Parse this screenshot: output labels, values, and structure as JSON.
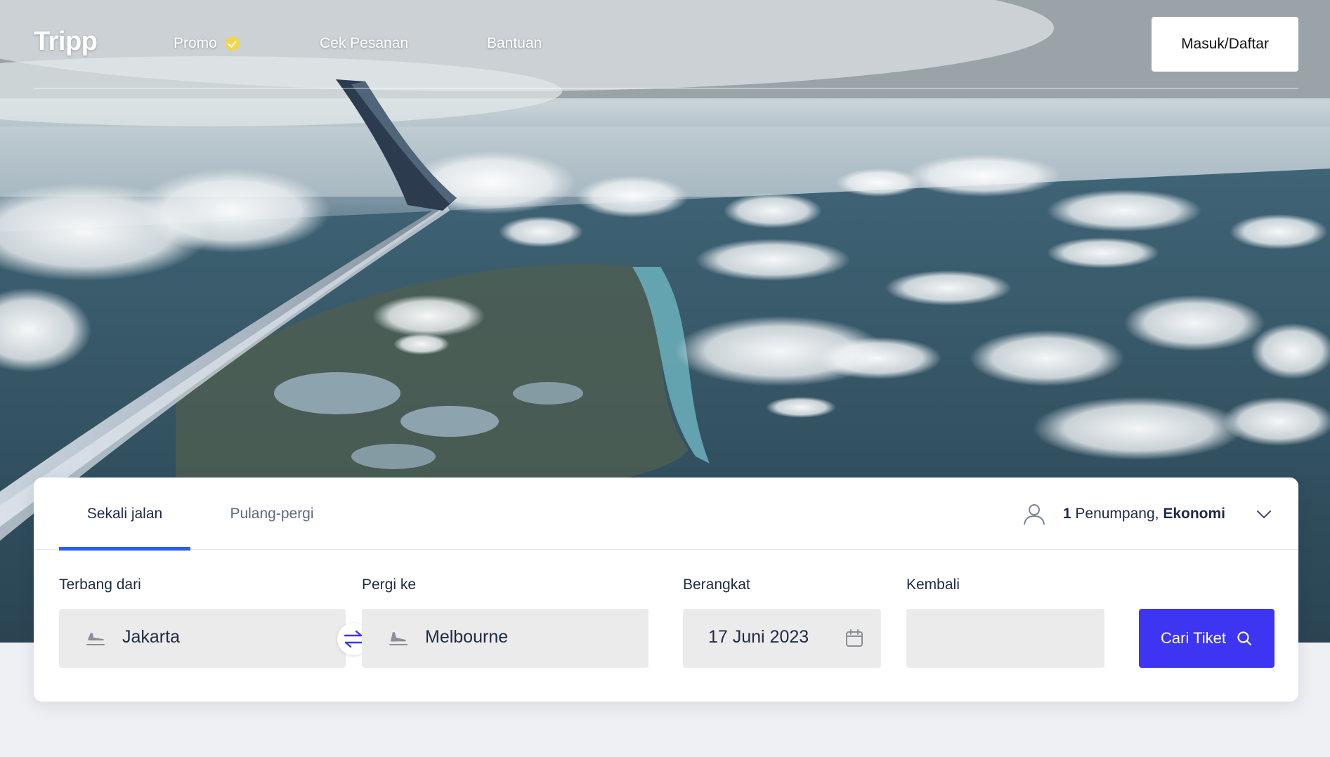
{
  "brand": {
    "logo": "Tripp"
  },
  "nav": {
    "links": [
      {
        "label": "Promo"
      },
      {
        "label": "Cek Pesanan"
      },
      {
        "label": "Bantuan"
      }
    ],
    "login_label": "Masuk/Daftar"
  },
  "search": {
    "tabs": [
      {
        "label": "Sekali jalan",
        "active": true
      },
      {
        "label": "Pulang-pergi",
        "active": false
      }
    ],
    "passenger": {
      "count": "1",
      "text": " Penumpang, ",
      "class": "Ekonomi"
    },
    "fields": {
      "from": {
        "label": "Terbang dari",
        "value": "Jakarta"
      },
      "to": {
        "label": "Pergi ke",
        "value": "Melbourne"
      },
      "depart": {
        "label": "Berangkat",
        "value": "17 Juni 2023"
      },
      "return": {
        "label": "Kembali",
        "value": ""
      }
    },
    "submit_label": "Cari Tiket"
  },
  "colors": {
    "accent": "#3d35f2",
    "tab_underline": "#2b5fe8",
    "promo_badge": "#f2d64b",
    "page_bg": "#eff0f4"
  }
}
